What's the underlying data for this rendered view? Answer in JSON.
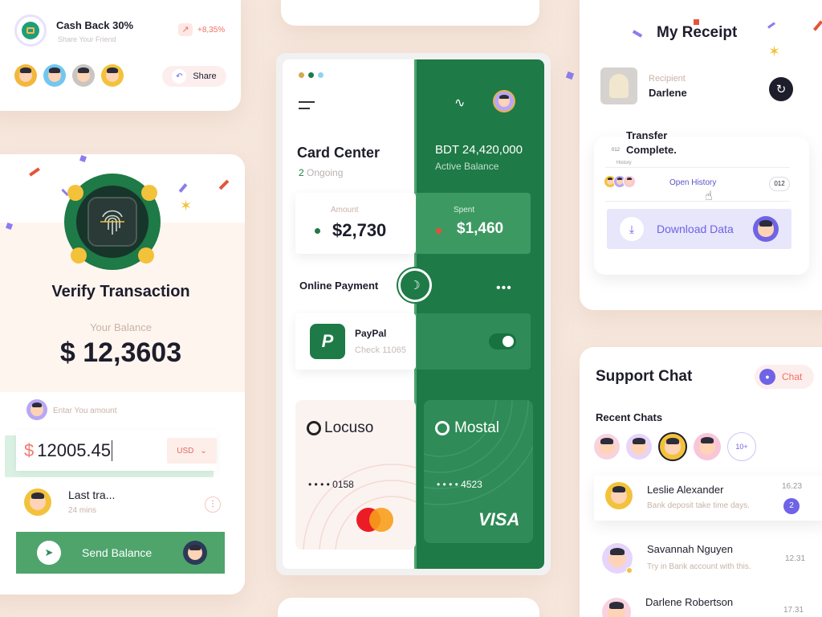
{
  "cashback": {
    "title": "Cash Back 30%",
    "subtitle": "Share Your Friend",
    "change": "+8,35%",
    "share_label": "Share"
  },
  "verify": {
    "title": "Verify Transaction",
    "balance_label": "Your Balance",
    "balance_value": "$ 12,3603",
    "amount_placeholder": "Entar You amount",
    "currency_symbol": "$",
    "amount_value": "12005.45",
    "currency": "USD",
    "last_title": "Last tra...",
    "last_time": "24 mins",
    "send_label": "Send Balance"
  },
  "card_center": {
    "title": "Card Center",
    "ongoing_count": "2",
    "ongoing_label": "Ongoing",
    "balance": "BDT 24,420,000",
    "balance_label": "Active Balance",
    "amount_label": "Amount",
    "amount_value": "$2,730",
    "spent_label": "Spent",
    "spent_value": "$1,460",
    "online_payment": "Online Payment",
    "paypal_name": "PayPal",
    "paypal_check": "Check 11065",
    "card1_brand": "Locuso",
    "card1_number": "• • • •  0158",
    "card2_brand": "Mostal",
    "card2_number": "• • • •  4523",
    "card2_network": "VISA"
  },
  "receipt": {
    "title": "My Receipt",
    "recipient_label": "Recipient",
    "recipient_name": "Darlene",
    "transfer_line1": "Transfer",
    "transfer_line2": "Complete.",
    "history_small": "History",
    "small_code": "012",
    "open_history": "Open History",
    "history_count": "012",
    "download_label": "Download Data"
  },
  "support": {
    "title": "Support Chat",
    "chat_button": "Chat",
    "recent_label": "Recent Chats",
    "more_count": "10+",
    "chats": [
      {
        "name": "Leslie Alexander",
        "message": "Bank deposit take time days.",
        "time": "16.23",
        "badge": "2"
      },
      {
        "name": "Savannah Nguyen",
        "message": "Try in Bank account with this.",
        "time": "12.31"
      },
      {
        "name": "Darlene Robertson",
        "message": "",
        "time": "17.31"
      }
    ]
  },
  "colors": {
    "green": "#1e7a46",
    "green_light": "#2f8b57",
    "purple": "#6f63e6",
    "coral": "#f06b6b",
    "background": "#f6e7dd"
  }
}
